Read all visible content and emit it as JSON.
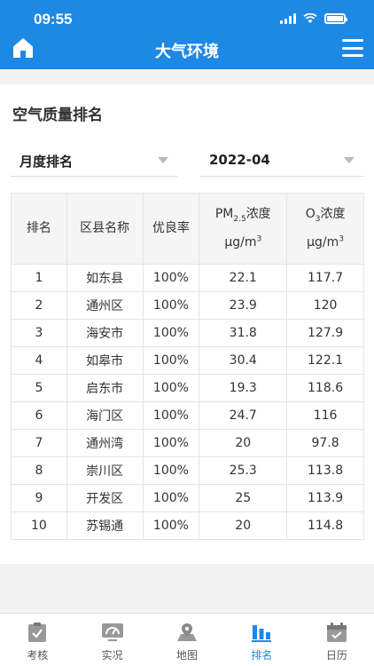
{
  "status": {
    "time": "09:55"
  },
  "header": {
    "title": "大气环境"
  },
  "section_title": "空气质量排名",
  "filters": {
    "rank_type": "月度排名",
    "period": "2022-04"
  },
  "table": {
    "headers": {
      "rank": "排名",
      "district": "区县名称",
      "good_rate": "优良率",
      "pm25_name": "PM",
      "pm25_sub": "2.5",
      "pm25_suffix": "浓度",
      "o3_name": "O",
      "o3_sub": "3",
      "o3_suffix": "浓度",
      "unit": "μg/m",
      "unit_sup": "3"
    },
    "rows": [
      {
        "rank": "1",
        "district": "如东县",
        "good_rate": "100%",
        "pm25": "22.1",
        "o3": "117.7"
      },
      {
        "rank": "2",
        "district": "通州区",
        "good_rate": "100%",
        "pm25": "23.9",
        "o3": "120"
      },
      {
        "rank": "3",
        "district": "海安市",
        "good_rate": "100%",
        "pm25": "31.8",
        "o3": "127.9"
      },
      {
        "rank": "4",
        "district": "如皋市",
        "good_rate": "100%",
        "pm25": "30.4",
        "o3": "122.1"
      },
      {
        "rank": "5",
        "district": "启东市",
        "good_rate": "100%",
        "pm25": "19.3",
        "o3": "118.6"
      },
      {
        "rank": "6",
        "district": "海门区",
        "good_rate": "100%",
        "pm25": "24.7",
        "o3": "116"
      },
      {
        "rank": "7",
        "district": "通州湾",
        "good_rate": "100%",
        "pm25": "20",
        "o3": "97.8"
      },
      {
        "rank": "8",
        "district": "崇川区",
        "good_rate": "100%",
        "pm25": "25.3",
        "o3": "113.8"
      },
      {
        "rank": "9",
        "district": "开发区",
        "good_rate": "100%",
        "pm25": "25",
        "o3": "113.9"
      },
      {
        "rank": "10",
        "district": "苏锡通",
        "good_rate": "100%",
        "pm25": "20",
        "o3": "114.8"
      }
    ]
  },
  "tabbar": {
    "items": [
      {
        "label": "考核",
        "icon": "clipboard-check-icon"
      },
      {
        "label": "实况",
        "icon": "monitor-icon"
      },
      {
        "label": "地图",
        "icon": "map-pin-icon"
      },
      {
        "label": "排名",
        "icon": "bar-chart-icon"
      },
      {
        "label": "日历",
        "icon": "calendar-icon"
      }
    ],
    "active_index": 3
  },
  "colors": {
    "primary": "#1e88e5"
  }
}
